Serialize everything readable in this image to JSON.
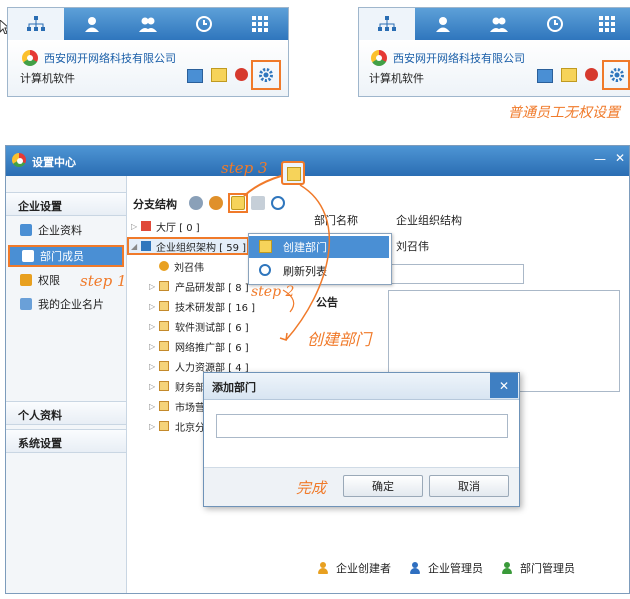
{
  "top_panel_left": {
    "tab_icons": [
      "org-tree-icon",
      "person-icon",
      "group-icon",
      "clock-icon",
      "grid-icon"
    ],
    "company": "西安网开网络科技有限公司",
    "subtitle": "计算机软件",
    "tool_icons": [
      "monitor-icon",
      "edit-doc-icon",
      "alert-icon",
      "settings-gear-icon"
    ]
  },
  "top_panel_right": {
    "tab_icons": [
      "org-tree-icon",
      "person-icon",
      "group-icon",
      "clock-icon",
      "grid-icon"
    ],
    "company": "西安网开网络科技有限公司",
    "subtitle": "计算机软件",
    "tool_icons": [
      "monitor-icon",
      "edit-doc-icon",
      "alert-icon",
      "settings-gear-icon"
    ],
    "note": "普通员工无权设置"
  },
  "window": {
    "title": "设置中心",
    "title_buttons": [
      "—",
      "✕"
    ]
  },
  "left_nav": {
    "sections": [
      {
        "title": "企业设置",
        "items": [
          "企业资料",
          "部门成员",
          "权限",
          "我的企业名片"
        ]
      },
      {
        "title": "个人资料",
        "items": []
      },
      {
        "title": "系统设置",
        "items": []
      }
    ],
    "active_item": "部门成员"
  },
  "tree": {
    "header": "分支结构",
    "toolbar_icons": [
      "add-person-icon",
      "add-member-icon",
      "add-department-icon",
      "edit-icon",
      "refresh-icon"
    ],
    "nodes": [
      {
        "label": "大厅 [ 0 ]"
      },
      {
        "label": "企业组织架构 [ 59 ]"
      },
      {
        "label": "刘召伟"
      },
      {
        "label": "产品研发部 [ 8 ]"
      },
      {
        "label": "技术研发部 [ 16 ]"
      },
      {
        "label": "软件测试部 [ 6 ]"
      },
      {
        "label": "网络推广部 [ 6 ]"
      },
      {
        "label": "人力资源部 [ 4 ]"
      },
      {
        "label": "财务部"
      },
      {
        "label": "市场营"
      },
      {
        "label": "北京分"
      }
    ]
  },
  "detail": {
    "dept_name_label": "部门名称",
    "dept_name_value": "企业组织结构",
    "manager_value": "刘召伟",
    "notice_label": "公告"
  },
  "legend": [
    "企业创建者",
    "企业管理员",
    "部门管理员"
  ],
  "legend_colors": [
    "#e8a020",
    "#2f6fc0",
    "#3a9a3a"
  ],
  "context_menu": {
    "items": [
      "创建部门",
      "刷新列表"
    ]
  },
  "dialog": {
    "title": "添加部门",
    "input_value": "",
    "ok": "确定",
    "cancel": "取消",
    "close": "✕"
  },
  "annotations": {
    "step1": "step 1",
    "step2": "step 2",
    "step3": "step 3",
    "create_dept": "创建部门",
    "done": "完成"
  },
  "colors": {
    "accent": "#f07a2a",
    "titlebar": "#2a6db3",
    "selected": "#4a8fd4"
  }
}
